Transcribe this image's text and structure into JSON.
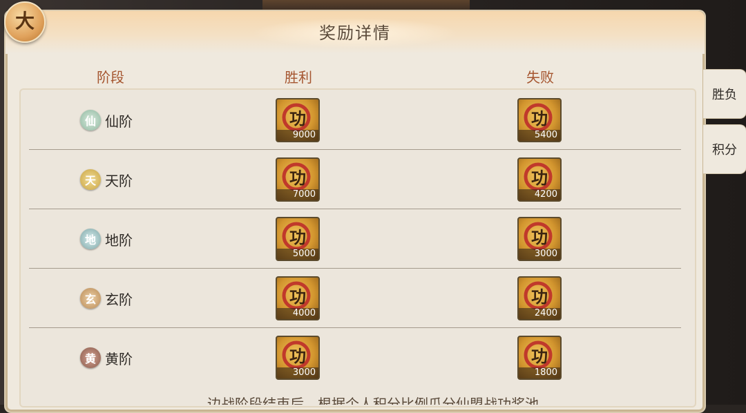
{
  "header": {
    "title": "奖励详情"
  },
  "columns": {
    "stage": "阶段",
    "win": "胜利",
    "lose": "失败"
  },
  "side_tabs": [
    {
      "label": "胜负"
    },
    {
      "label": "积分"
    }
  ],
  "rows": [
    {
      "tier": "仙阶",
      "icon": "tier-xian-icon",
      "icon_color": "#8fb8a0",
      "win_amount": "9000",
      "lose_amount": "5400"
    },
    {
      "tier": "天阶",
      "icon": "tier-tian-icon",
      "icon_color": "#c9a441",
      "win_amount": "7000",
      "lose_amount": "4200"
    },
    {
      "tier": "地阶",
      "icon": "tier-di-icon",
      "icon_color": "#7fa7a8",
      "win_amount": "5000",
      "lose_amount": "3000"
    },
    {
      "tier": "玄阶",
      "icon": "tier-xuan-icon",
      "icon_color": "#b98a54",
      "win_amount": "4000",
      "lose_amount": "2400"
    },
    {
      "tier": "黄阶",
      "icon": "tier-huang-icon",
      "icon_color": "#8a5a4a",
      "win_amount": "3000",
      "lose_amount": "1800"
    }
  ],
  "footer": {
    "note": "边战阶段结束后，根据个人积分比例瓜分仙盟战功奖池"
  },
  "colors": {
    "accent": "#a5552f",
    "panel_bg": "#efe9de"
  }
}
